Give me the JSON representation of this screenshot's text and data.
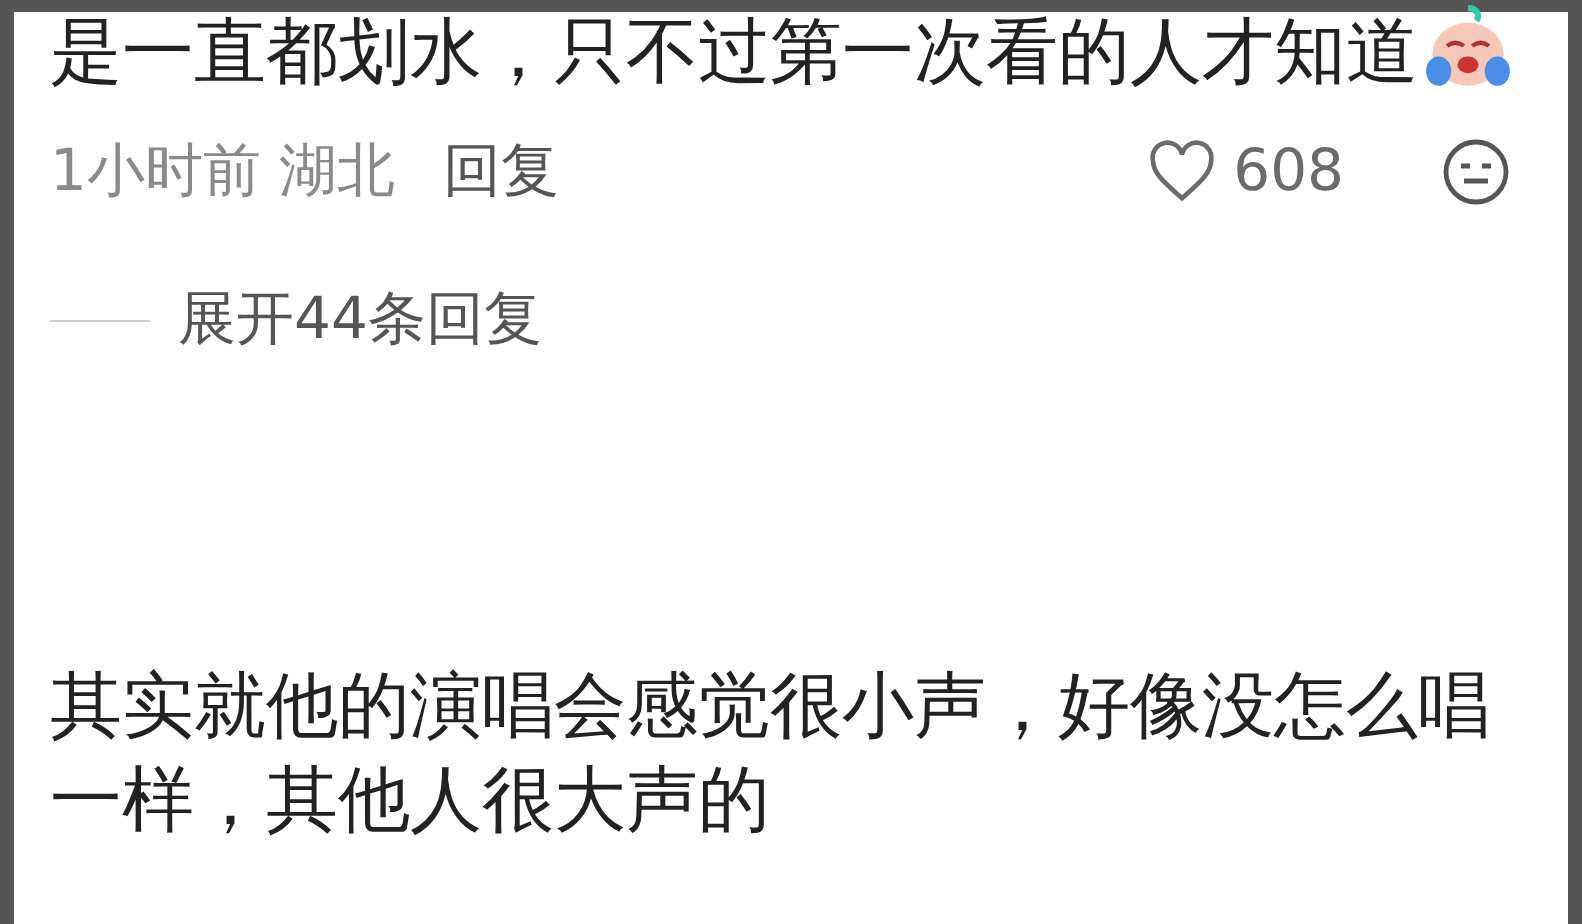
{
  "comments": [
    {
      "text": "是一直都划水，只不过第一次看的人才知道",
      "emoji": true,
      "meta": "1小时前 湖北",
      "reply": "回复",
      "likes": "608",
      "expand": "展开44条回复"
    },
    {
      "text": "其实就他的演唱会感觉很小声，好像没怎么唱一样，其他人很大声的",
      "emoji": false
    }
  ]
}
